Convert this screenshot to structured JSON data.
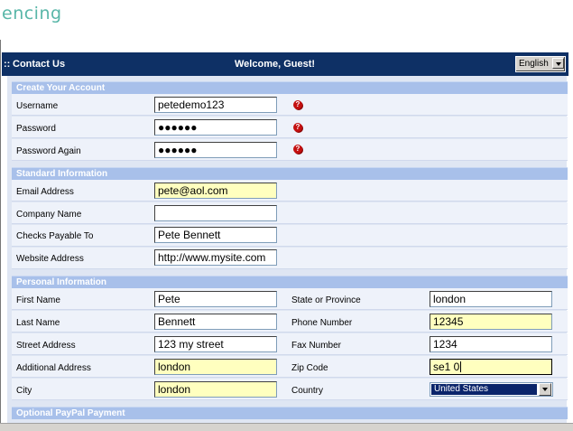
{
  "logo_text": "encing",
  "nav": {
    "dots": "::",
    "contact": "Contact Us",
    "welcome": "Welcome, Guest!",
    "language": "English"
  },
  "sections": {
    "create": "Create Your Account",
    "standard": "Standard Information",
    "personal": "Personal Information",
    "paypal": "Optional PayPal Payment"
  },
  "fields": {
    "username": {
      "label": "Username",
      "value": "petedemo123"
    },
    "password": {
      "label": "Password",
      "value": "●●●●●●"
    },
    "password_again": {
      "label": "Password Again",
      "value": "●●●●●●"
    },
    "email": {
      "label": "Email Address",
      "value": "pete@aol.com"
    },
    "company": {
      "label": "Company Name",
      "value": ""
    },
    "checks_payable": {
      "label": "Checks Payable To",
      "value": "Pete Bennett"
    },
    "website": {
      "label": "Website Address",
      "value": "http://www.mysite.com"
    },
    "first_name": {
      "label": "First Name",
      "value": "Pete"
    },
    "last_name": {
      "label": "Last Name",
      "value": "Bennett"
    },
    "street": {
      "label": "Street Address",
      "value": "123 my street"
    },
    "additional": {
      "label": "Additional Address",
      "value": "london"
    },
    "city": {
      "label": "City",
      "value": "london"
    },
    "state": {
      "label": "State or Province",
      "value": "london"
    },
    "phone": {
      "label": "Phone Number",
      "value": "12345"
    },
    "fax": {
      "label": "Fax Number",
      "value": "1234"
    },
    "zip": {
      "label": "Zip Code",
      "value": "se1 0"
    },
    "country": {
      "label": "Country",
      "value": "United States"
    }
  },
  "error_mark": "?"
}
